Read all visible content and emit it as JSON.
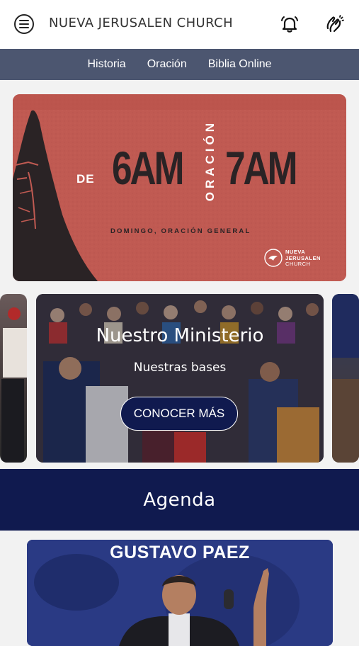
{
  "app": {
    "title": "NUEVA JERUSALEN CHURCH"
  },
  "icons": {
    "menu": "menu-icon",
    "notifications": "bell-icon",
    "prayer": "praying-hands-icon"
  },
  "nav": {
    "items": [
      {
        "label": "Historia"
      },
      {
        "label": "Oración"
      },
      {
        "label": "Biblia Online"
      }
    ]
  },
  "banner": {
    "prefix": "DE",
    "start": "6AM",
    "middle": "ORACIÓN",
    "end": "7AM",
    "subtitle": "DOMINGO, ORACIÓN GENERAL",
    "logo_line1": "NUEVA",
    "logo_line2": "JERUSALEN",
    "logo_line3": "CHURCH",
    "background_color": "#c05a52"
  },
  "ministry_card": {
    "title": "Nuestro Ministerio",
    "subtitle": "Nuestras bases",
    "button_label": "CONOCER MÁS"
  },
  "agenda": {
    "title": "Agenda"
  },
  "event": {
    "speaker": "GUSTAVO PAEZ"
  },
  "colors": {
    "nav_bg": "#4c5670",
    "accent_navy": "#101a4f",
    "page_bg": "#f2f2f2"
  }
}
